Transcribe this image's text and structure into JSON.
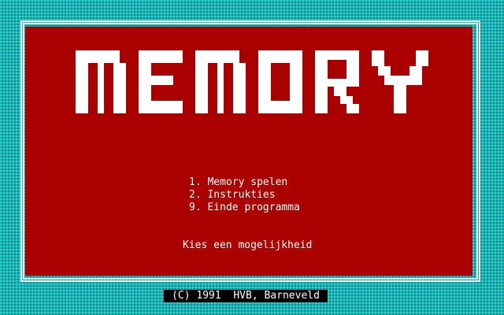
{
  "title": {
    "logo_text": "MEMORY"
  },
  "menu": {
    "items": [
      {
        "label": "1. Memory spelen"
      },
      {
        "label": "2. Instrukties"
      },
      {
        "label": "9. Einde programma"
      }
    ]
  },
  "prompt": "Kies een mogelijkheid",
  "footer": {
    "copyright": "(C) 1991  HVB, Barneveld"
  },
  "colors": {
    "background": "#1fb2b2",
    "panel": "#aa0000",
    "text": "#ffffff",
    "footer_bg": "#000000"
  }
}
